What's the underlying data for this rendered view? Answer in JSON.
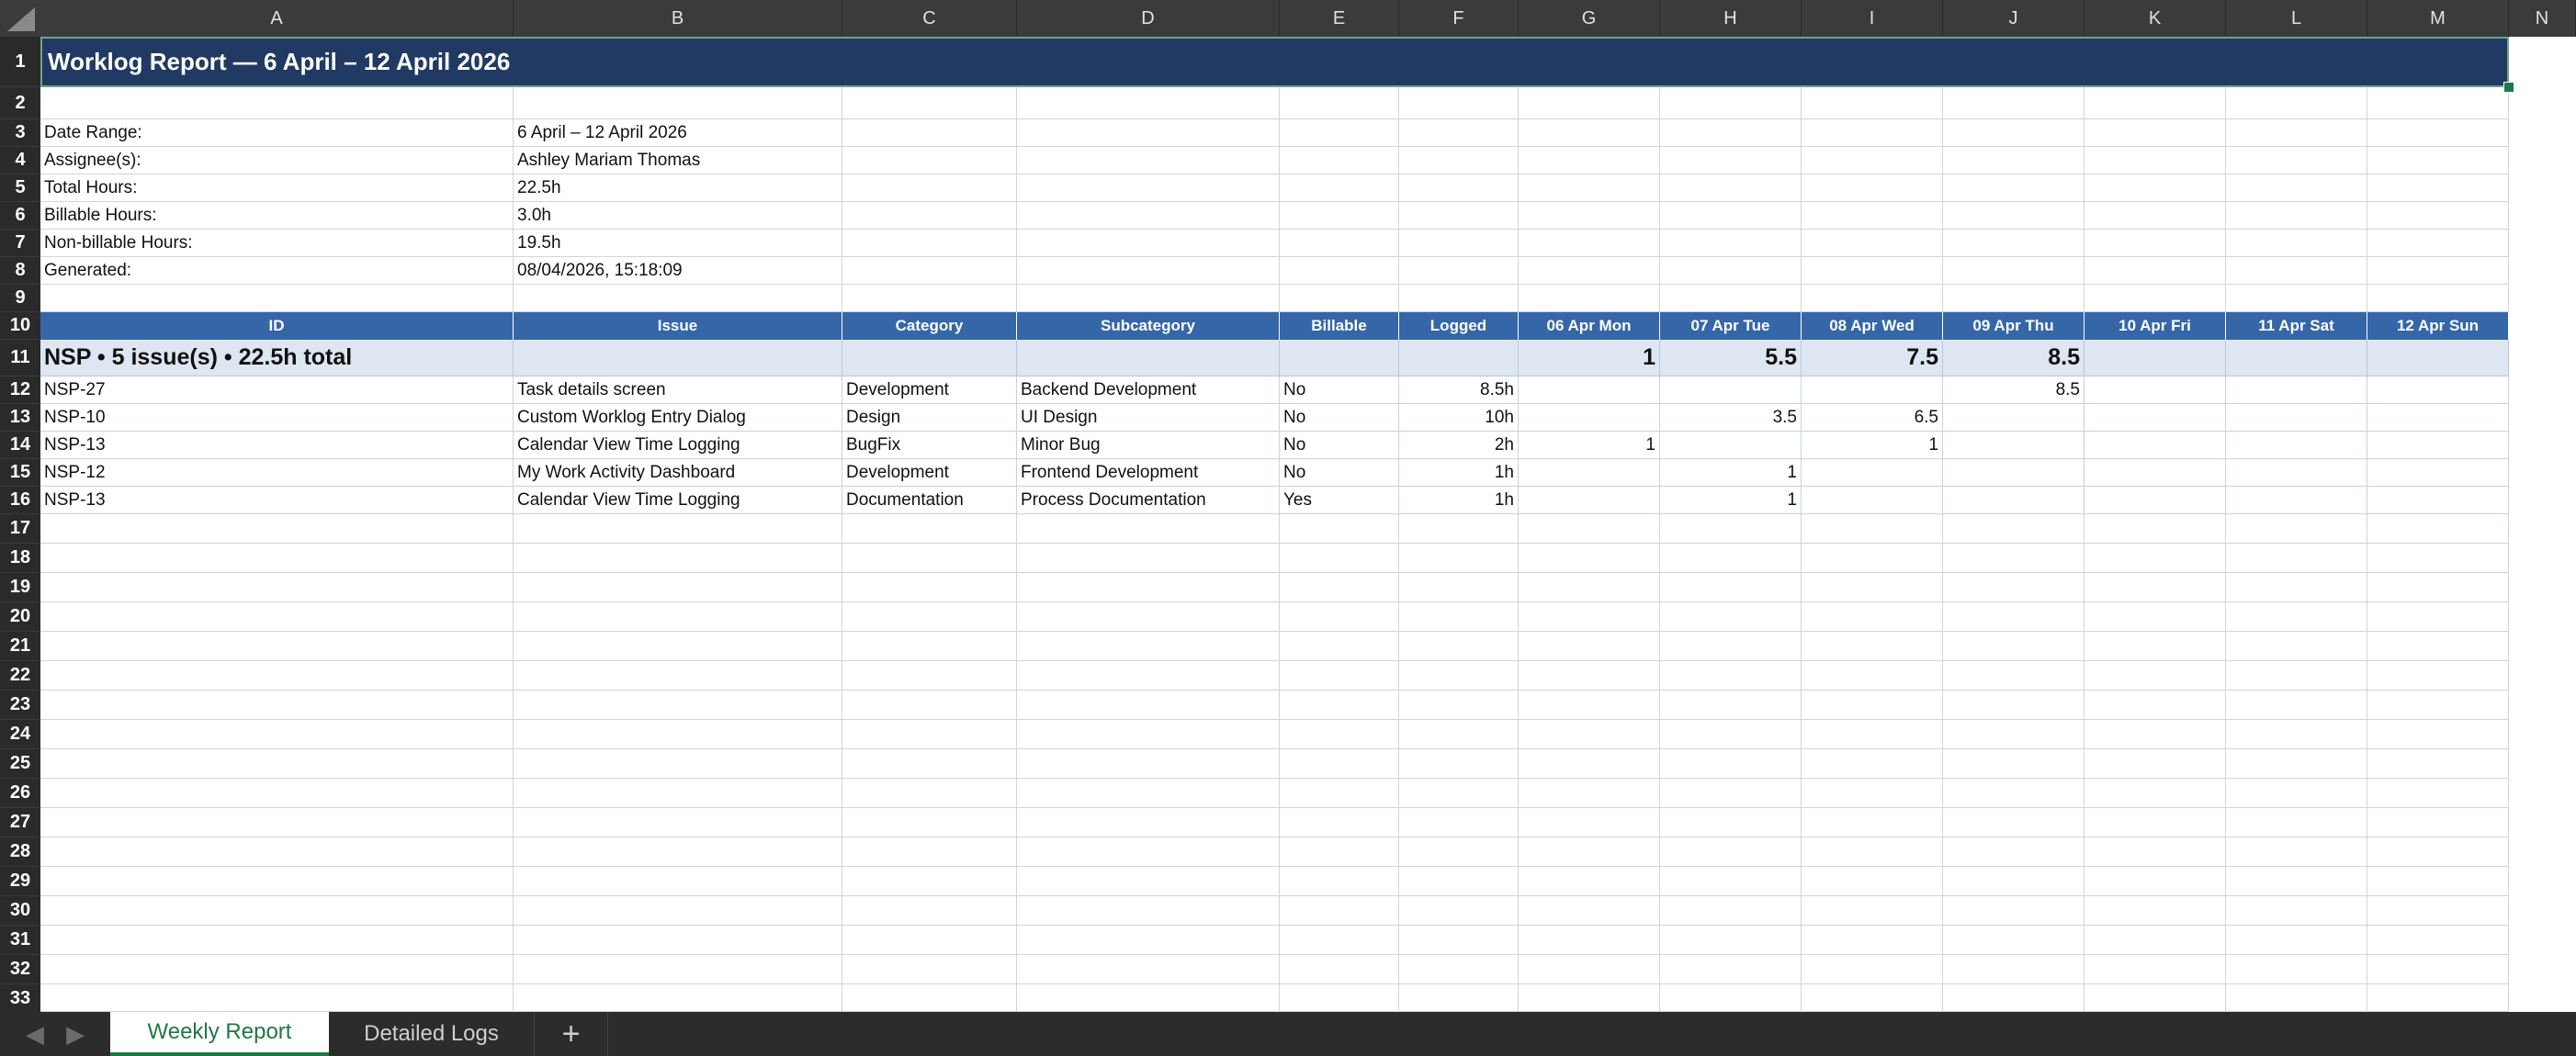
{
  "sheet": {
    "columns": [
      "A",
      "B",
      "C",
      "D",
      "E",
      "F",
      "G",
      "H",
      "I",
      "J",
      "K",
      "L",
      "M",
      "N"
    ],
    "rows": [
      "1",
      "2",
      "3",
      "4",
      "5",
      "6",
      "7",
      "8",
      "9",
      "10",
      "11",
      "12",
      "13",
      "14",
      "15",
      "16",
      "17",
      "18",
      "19",
      "20",
      "21",
      "22",
      "23",
      "24",
      "25",
      "26",
      "27",
      "28",
      "29",
      "30",
      "31",
      "32",
      "33"
    ]
  },
  "report": {
    "title": "Worklog Report — 6 April – 12 April 2026",
    "summary": [
      {
        "label": "Date Range:",
        "value": "6 April – 12 April 2026"
      },
      {
        "label": "Assignee(s):",
        "value": "Ashley Mariam Thomas"
      },
      {
        "label": "Total Hours:",
        "value": "22.5h"
      },
      {
        "label": "Billable Hours:",
        "value": "3.0h"
      },
      {
        "label": "Non-billable Hours:",
        "value": "19.5h"
      },
      {
        "label": "Generated:",
        "value": "08/04/2026, 15:18:09"
      }
    ]
  },
  "table": {
    "headers": [
      "ID",
      "Issue",
      "Category",
      "Subcategory",
      "Billable",
      "Logged",
      "06 Apr Mon",
      "07 Apr Tue",
      "08 Apr Wed",
      "09 Apr Thu",
      "10 Apr Fri",
      "11 Apr Sat",
      "12 Apr Sun"
    ],
    "group": {
      "label": "NSP • 5 issue(s) • 22.5h total",
      "g": "1",
      "h": "5.5",
      "i": "7.5",
      "j": "8.5"
    },
    "rows": [
      {
        "id": "NSP-27",
        "issue": "Task details screen",
        "category": "Development",
        "subcategory": "Backend Development",
        "billable": "No",
        "logged": "8.5h",
        "g": "",
        "h": "",
        "i": "",
        "j": "8.5"
      },
      {
        "id": "NSP-10",
        "issue": "Custom Worklog Entry Dialog",
        "category": "Design",
        "subcategory": "UI Design",
        "billable": "No",
        "logged": "10h",
        "g": "",
        "h": "3.5",
        "i": "6.5",
        "j": ""
      },
      {
        "id": "NSP-13",
        "issue": "Calendar View Time Logging",
        "category": "BugFix",
        "subcategory": "Minor Bug",
        "billable": "No",
        "logged": "2h",
        "g": "1",
        "h": "",
        "i": "1",
        "j": ""
      },
      {
        "id": "NSP-12",
        "issue": "My Work Activity Dashboard",
        "category": "Development",
        "subcategory": "Frontend Development",
        "billable": "No",
        "logged": "1h",
        "g": "",
        "h": "1",
        "i": "",
        "j": ""
      },
      {
        "id": "NSP-13",
        "issue": "Calendar View Time Logging",
        "category": "Documentation",
        "subcategory": "Process Documentation",
        "billable": "Yes",
        "logged": "1h",
        "g": "",
        "h": "1",
        "i": "",
        "j": ""
      }
    ]
  },
  "tabs": [
    {
      "label": "Weekly Report",
      "active": true
    },
    {
      "label": "Detailed Logs",
      "active": false
    }
  ],
  "add_tab_label": "+",
  "nav": {
    "prev": "◀",
    "next": "▶"
  },
  "colors": {
    "title_fill": "#213a63",
    "header_fill": "#3566a8",
    "group_fill": "#dde6f1",
    "active_tab_text": "#1e7845"
  }
}
